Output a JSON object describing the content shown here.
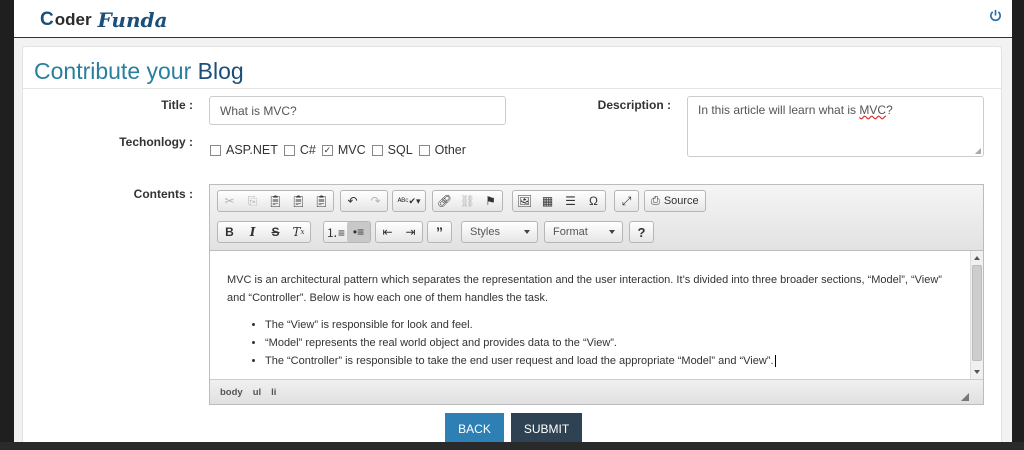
{
  "brand": {
    "logo_c": "C",
    "logo_oder": "oder",
    "logo_funda": "Funda",
    "accent": "#1b4f7a"
  },
  "header": {
    "power_icon": "power-icon"
  },
  "page": {
    "title_main": "Contribute your",
    "title_tail": "Blog",
    "title_color": "#2a7f9f"
  },
  "form": {
    "title_label": "Title :",
    "title_value": "What is MVC?",
    "description_label": "Description :",
    "description_value_prefix": "In this article will learn what is ",
    "description_value_word": "MVC",
    "description_value_suffix": "?",
    "technology_label": "Techonlogy :",
    "technologies": [
      {
        "label": "ASP.NET",
        "checked": false
      },
      {
        "label": "C#",
        "checked": false
      },
      {
        "label": "MVC",
        "checked": true
      },
      {
        "label": "SQL",
        "checked": false
      },
      {
        "label": "Other",
        "checked": false
      }
    ],
    "contents_label": "Contents :"
  },
  "editor": {
    "source_label": "Source",
    "styles_label": "Styles",
    "format_label": "Format",
    "help_label": "?",
    "paragraph": "MVC is an architectural pattern which separates the representation and the user interaction. It’s divided into three broader sections, “Model”, “View” and “Controller”. Below is how each one of them handles the task.",
    "bullets": [
      "The “View” is responsible for look and feel.",
      "“Model” represents the real world object and provides data to the “View”.",
      "The “Controller” is responsible to take the end user request and load the appropriate “Model” and “View”."
    ],
    "path": [
      "body",
      "ul",
      "li"
    ]
  },
  "actions": {
    "back_label": "BACK",
    "submit_label": "SUBMIT",
    "back_color": "#2e7fb3",
    "submit_color": "#2e4253"
  }
}
